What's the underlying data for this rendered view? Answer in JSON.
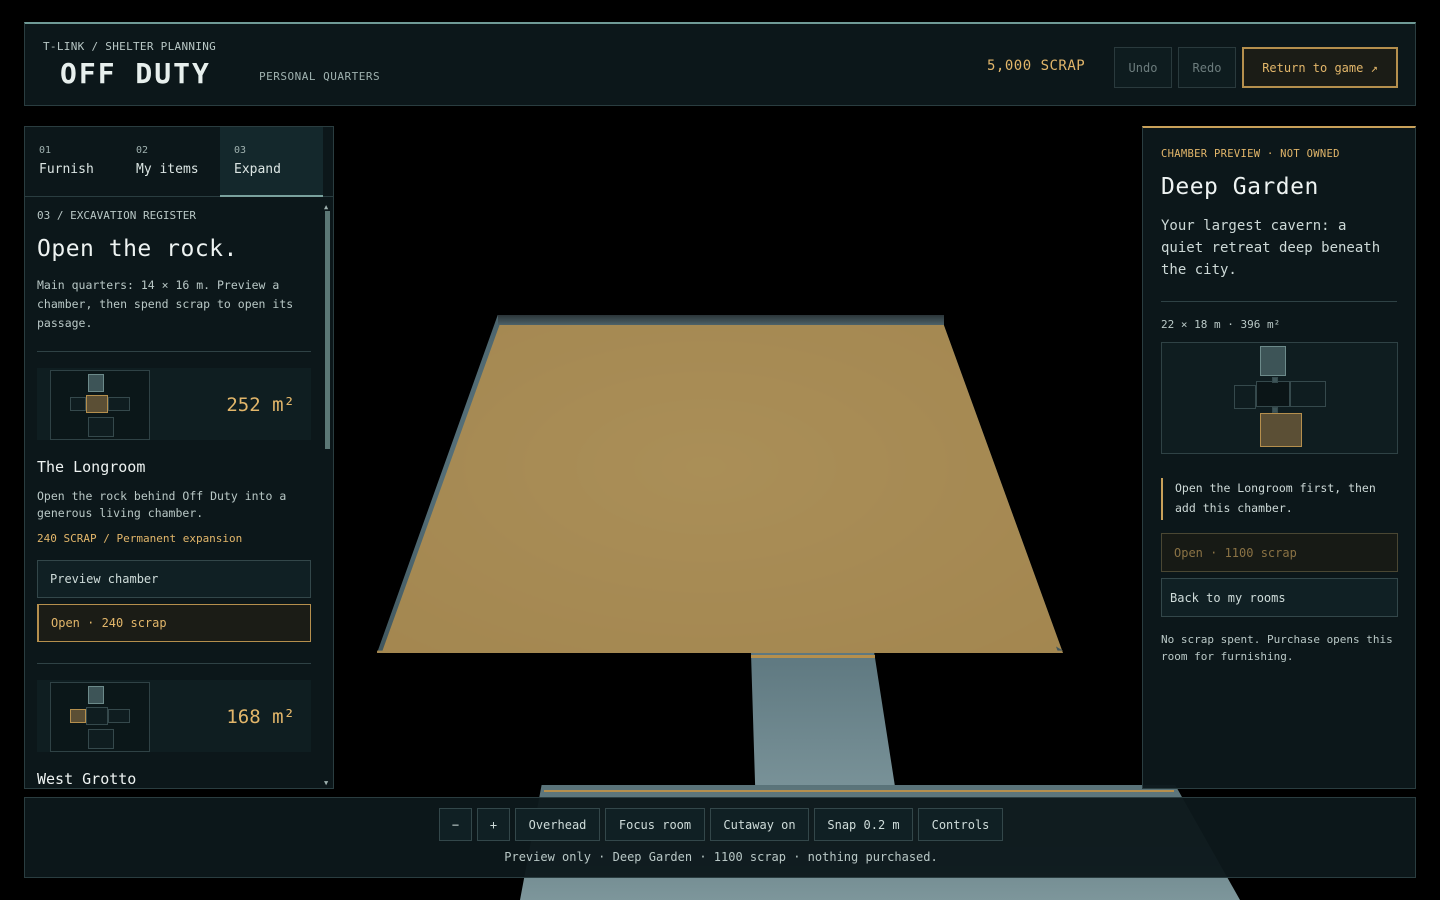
{
  "header": {
    "breadcrumb": "T-LINK / SHELTER PLANNING",
    "logo": "OFF DUTY",
    "subtitle": "PERSONAL QUARTERS",
    "scrap": "5,000 SCRAP",
    "undo": "Undo",
    "redo": "Redo",
    "return": "Return to game ↗"
  },
  "tabs": [
    {
      "num": "01",
      "label": "Furnish"
    },
    {
      "num": "02",
      "label": "My items"
    },
    {
      "num": "03",
      "label": "Expand"
    }
  ],
  "left": {
    "section_tag": "03 / EXCAVATION REGISTER",
    "heading": "Open the rock.",
    "description": "Main quarters: 14 × 16 m. Preview a chamber, then spend scrap to open its passage.",
    "chambers": [
      {
        "area": "252 m²",
        "name": "The Longroom",
        "description": "Open the rock behind Off Duty into a generous living chamber.",
        "price": "240 SCRAP / Permanent expansion",
        "preview": "Preview chamber",
        "open": "Open · 240 scrap"
      },
      {
        "area": "168 m²",
        "name": "West Grotto"
      }
    ]
  },
  "right": {
    "tag": "CHAMBER PREVIEW · NOT OWNED",
    "title": "Deep Garden",
    "description": "Your largest cavern: a quiet retreat deep beneath the city.",
    "size": "22 × 18 m · 396 m²",
    "note": "Open the Longroom first, then add this chamber.",
    "open": "Open · 1100 scrap",
    "back": "Back to my rooms",
    "footer": "No scrap spent. Purchase opens this room for furnishing."
  },
  "toolbar": {
    "zoom_out": "−",
    "zoom_in": "+",
    "overhead": "Overhead",
    "focus": "Focus room",
    "cutaway": "Cutaway on",
    "snap": "Snap 0.2 m",
    "controls": "Controls",
    "status": "Preview only · Deep Garden · 1100 scrap · nothing purchased."
  },
  "colors": {
    "accent_gold": "#e2b66a",
    "teal_border": "#6f9a96",
    "panel_bg": "#0c181b"
  }
}
